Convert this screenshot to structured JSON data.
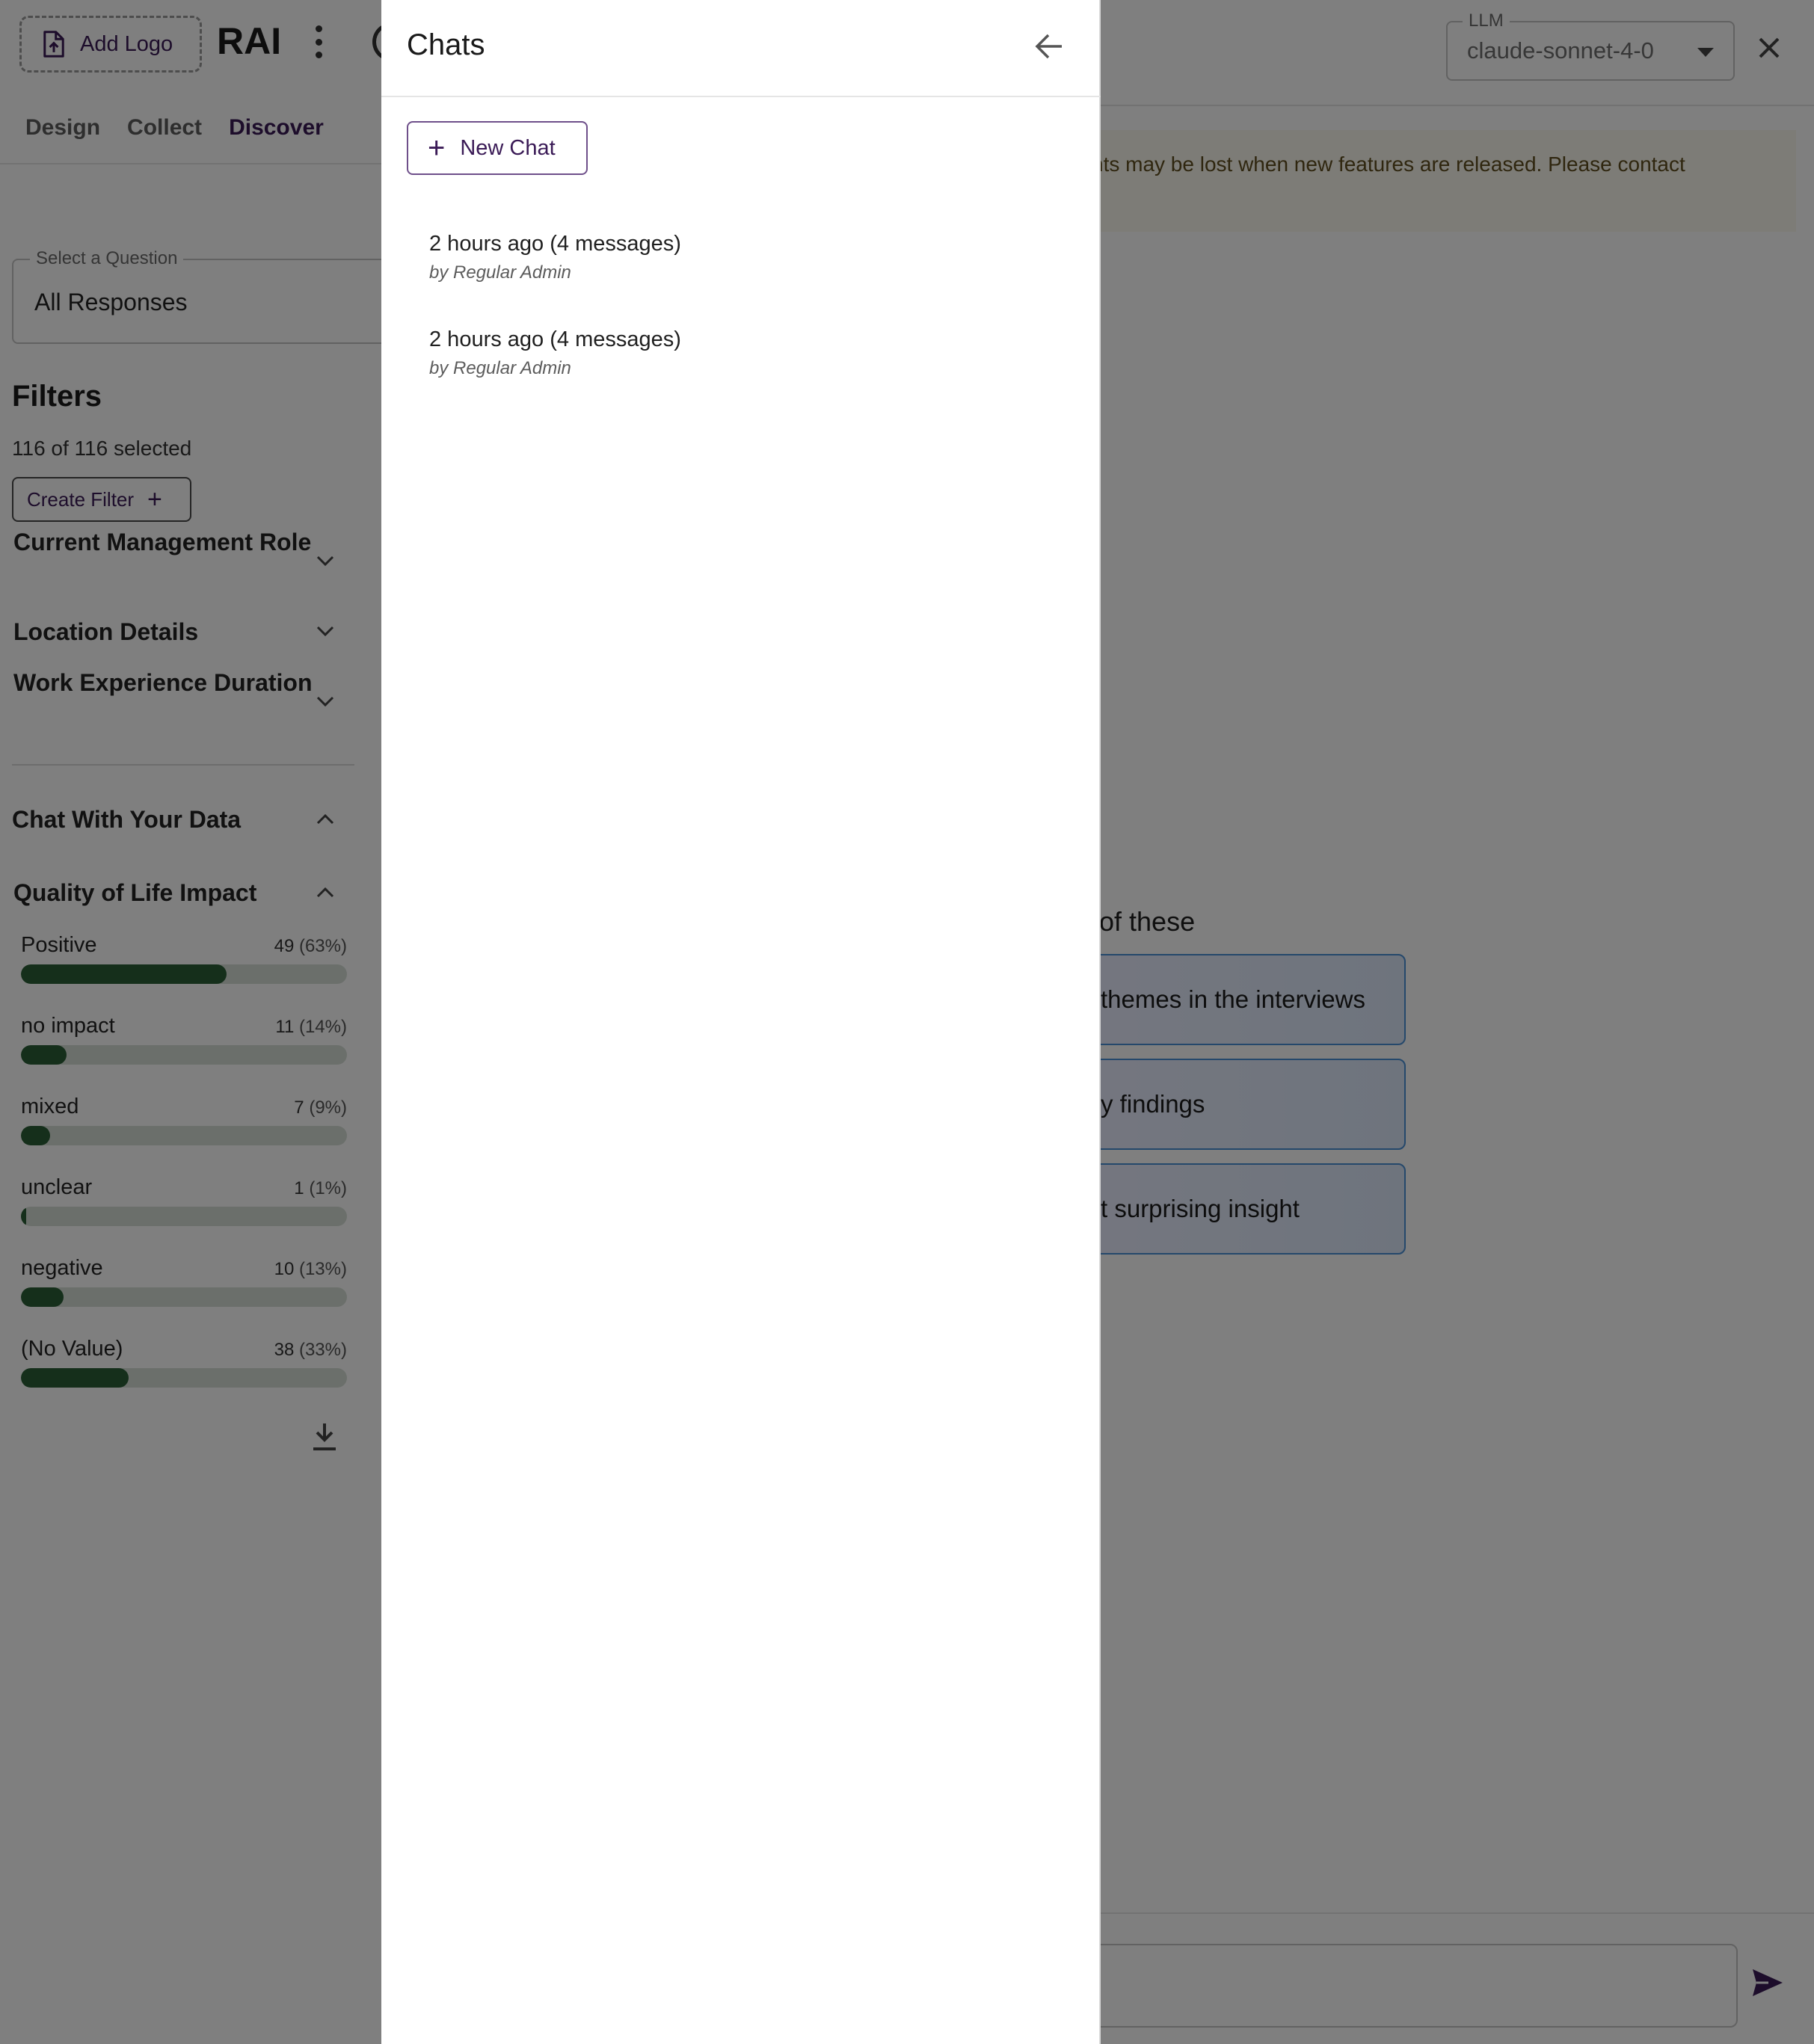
{
  "header": {
    "add_logo_label": "Add Logo",
    "brand": "RAI"
  },
  "tabs": [
    {
      "label": "Design",
      "active": false
    },
    {
      "label": "Collect",
      "active": false
    },
    {
      "label": "Discover",
      "active": true
    }
  ],
  "question_select": {
    "legend": "Select a Question",
    "value": "All Responses"
  },
  "filters": {
    "title": "Filters",
    "count_text": "116 of 116 selected",
    "create_filter_label": "Create Filter",
    "facets": [
      {
        "label": "Current Management Role",
        "expanded": false
      },
      {
        "label": "Location Details",
        "expanded": false
      },
      {
        "label": "Work Experience Duration",
        "expanded": false
      }
    ]
  },
  "sections": {
    "chat_with_data": "Chat With Your Data",
    "quality_of_life": "Quality of Life Impact"
  },
  "quality_bars": [
    {
      "label": "Positive",
      "count": "49",
      "pct": "(63%)",
      "fill": 0.63
    },
    {
      "label": "no impact",
      "count": "11",
      "pct": "(14%)",
      "fill": 0.14
    },
    {
      "label": "mixed",
      "count": "7",
      "pct": "(9%)",
      "fill": 0.09
    },
    {
      "label": "unclear",
      "count": "1",
      "pct": "(1%)",
      "fill": 0.01
    },
    {
      "label": "negative",
      "count": "10",
      "pct": "(13%)",
      "fill": 0.13
    },
    {
      "label": "(No Value)",
      "count": "38",
      "pct": "(33%)",
      "fill": 0.33
    }
  ],
  "chat_panel": {
    "llm_legend": "LLM",
    "llm_value": "claude-sonnet-4-0",
    "notice_text": "nts may be lost when new features are released. Please contact",
    "prompt_heading": "of these",
    "suggestions": [
      "themes in the interviews",
      "y findings",
      "t surprising insight"
    ]
  },
  "drawer": {
    "title": "Chats",
    "new_chat_label": "New Chat",
    "chats": [
      {
        "title": "2 hours ago (4 messages)",
        "author": "by Regular Admin"
      },
      {
        "title": "2 hours ago (4 messages)",
        "author": "by Regular Admin"
      }
    ]
  },
  "colors": {
    "brand_purple": "#3a1a56",
    "bar_fill": "#2a5f36",
    "bar_track": "#d6dfd7",
    "suggestion_border": "#4a90d6",
    "notice_bg": "#fbf9ee"
  }
}
